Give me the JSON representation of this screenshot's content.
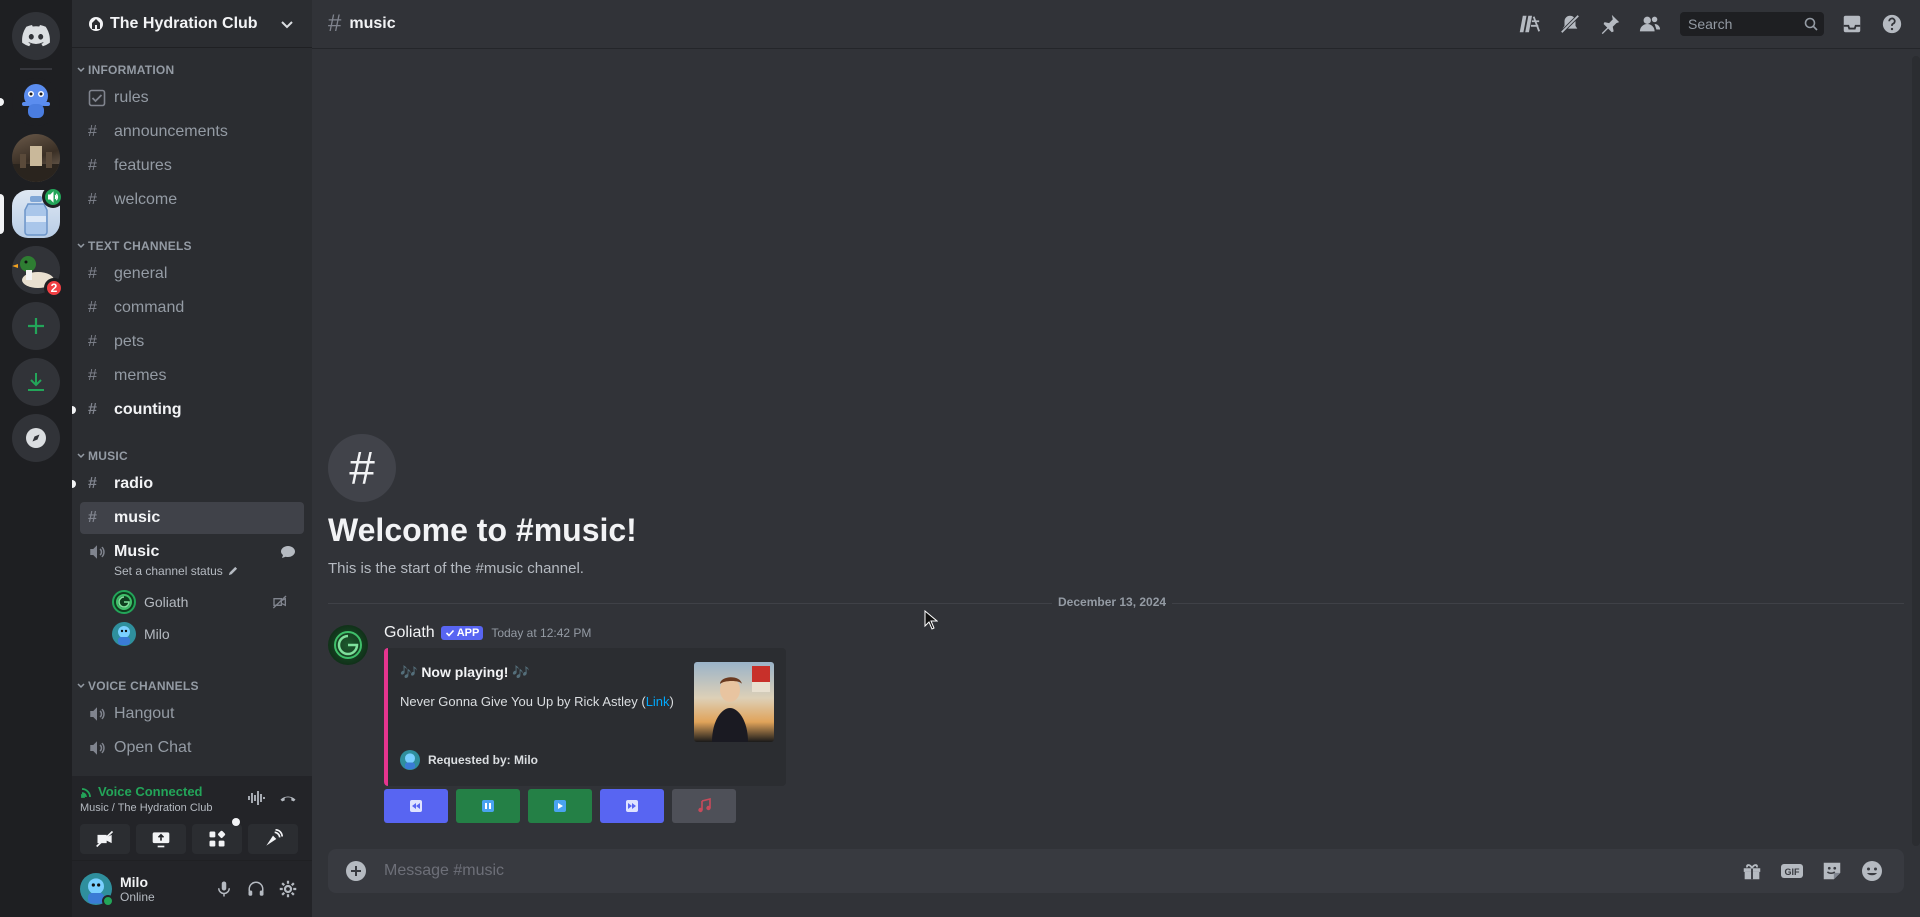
{
  "server": {
    "name": "The Hydration Club",
    "home_icon": "discord-logo-icon",
    "add_icon": "plus-icon",
    "download_icon": "download-icon",
    "discover_icon": "compass-icon",
    "badge_count": "2"
  },
  "sidebar": {
    "categories": [
      {
        "label": "INFORMATION",
        "channels": [
          "rules",
          "announcements",
          "features",
          "welcome"
        ]
      },
      {
        "label": "TEXT CHANNELS",
        "channels": [
          "general",
          "command",
          "pets",
          "memes",
          "counting"
        ]
      },
      {
        "label": "MUSIC",
        "channels": [
          "radio",
          "music"
        ]
      },
      {
        "label": "VOICE CHANNELS",
        "channels": [
          "Hangout",
          "Open Chat"
        ]
      }
    ],
    "voice_channel": {
      "name": "Music",
      "status": "Set a channel status",
      "users": [
        "Goliath",
        "Milo"
      ]
    }
  },
  "voice_panel": {
    "status": "Voice Connected",
    "location": "Music / The Hydration Club"
  },
  "user_panel": {
    "name": "Milo",
    "status": "Online"
  },
  "topbar": {
    "channel": "music",
    "search_placeholder": "Search"
  },
  "welcome": {
    "title": "Welcome to #music!",
    "subtitle": "This is the start of the #music channel."
  },
  "divider_date": "December 13, 2024",
  "message": {
    "author": "Goliath",
    "tag": "APP",
    "timestamp": "Today at 12:42 PM",
    "embed": {
      "title": "🎶 Now playing! 🎶",
      "desc_prefix": "Never Gonna Give You Up by Rick Astley (",
      "link": "Link",
      "desc_suffix": ")",
      "footer": "Requested by: Milo",
      "accent": "#e6358f"
    },
    "buttons": [
      {
        "icon": "previous-track-icon",
        "color": "#5865f2"
      },
      {
        "icon": "pause-icon",
        "color": "#248046"
      },
      {
        "icon": "play-icon",
        "color": "#248046"
      },
      {
        "icon": "skip-track-icon",
        "color": "#5865f2"
      },
      {
        "icon": "music-notes-icon",
        "color": "#4e5058"
      }
    ]
  },
  "composer": {
    "placeholder": "Message #music"
  },
  "colors": {
    "brand": "#5865f2",
    "green": "#23a559",
    "red": "#f23f43"
  }
}
